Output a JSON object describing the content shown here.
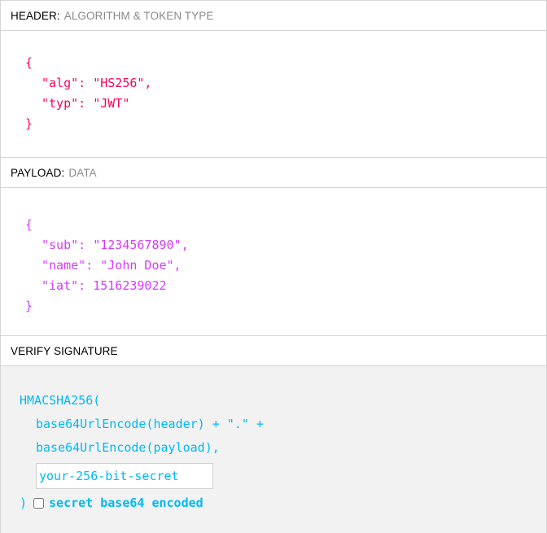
{
  "header_section": {
    "title": "HEADER:",
    "subtitle": "ALGORITHM & TOKEN TYPE",
    "code": {
      "open": "{",
      "lines": [
        "\"alg\": \"HS256\",",
        "\"typ\": \"JWT\""
      ],
      "close": "}"
    }
  },
  "payload_section": {
    "title": "PAYLOAD:",
    "subtitle": "DATA",
    "code": {
      "open": "{",
      "lines": [
        "\"sub\": \"1234567890\",",
        "\"name\": \"John Doe\",",
        "\"iat\": 1516239022"
      ],
      "close": "}"
    }
  },
  "verify_section": {
    "title": "VERIFY SIGNATURE",
    "fn_open": "HMACSHA256(",
    "arg1": "base64UrlEncode(header) + \".\" +",
    "arg2": "base64UrlEncode(payload),",
    "secret_placeholder": "your-256-bit-secret",
    "fn_close": ")",
    "checkbox_label": "secret base64 encoded",
    "checkbox_checked": false
  },
  "colors": {
    "header_code": "#fb015b",
    "payload_code": "#d63aff",
    "signature_code": "#00b9f1"
  }
}
